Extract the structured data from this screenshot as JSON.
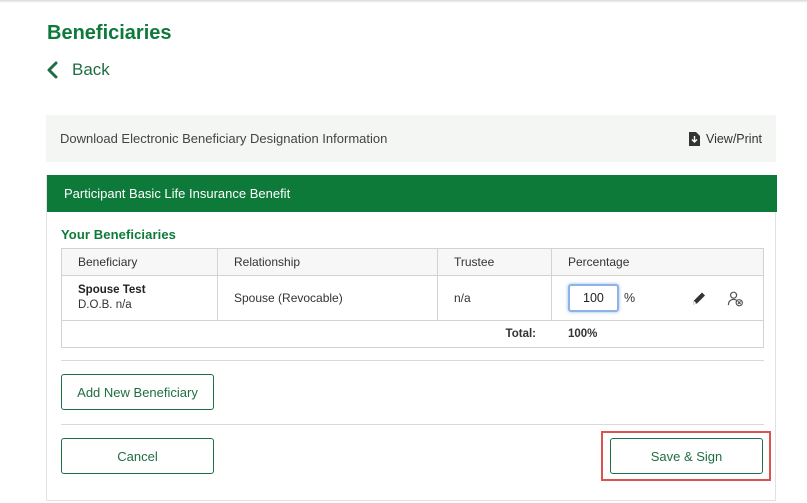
{
  "page": {
    "title": "Beneficiaries",
    "back_label": "Back"
  },
  "download_bar": {
    "text": "Download Electronic Beneficiary Designation Information",
    "view_print_label": "View/Print",
    "icon": "download-file-icon"
  },
  "card": {
    "header": "Participant Basic Life Insurance Benefit",
    "section_title": "Your Beneficiaries",
    "table": {
      "columns": [
        "Beneficiary",
        "Relationship",
        "Trustee",
        "Percentage"
      ],
      "rows": [
        {
          "name": "Spouse Test",
          "dob": "D.O.B. n/a",
          "relationship": "Spouse (Revocable)",
          "trustee": "n/a",
          "percentage": "100",
          "percent_sign": "%",
          "edit_icon": "pencil-icon",
          "remove_icon": "remove-user-icon"
        }
      ],
      "total_label": "Total:",
      "total_value": "100%"
    },
    "add_button": "Add New Beneficiary",
    "cancel_button": "Cancel",
    "save_button": "Save & Sign"
  },
  "colors": {
    "brand_green": "#0e7a3a",
    "link_green": "#1f6e43",
    "highlight_red": "#d9534f",
    "bar_background": "#f3f6f3"
  }
}
